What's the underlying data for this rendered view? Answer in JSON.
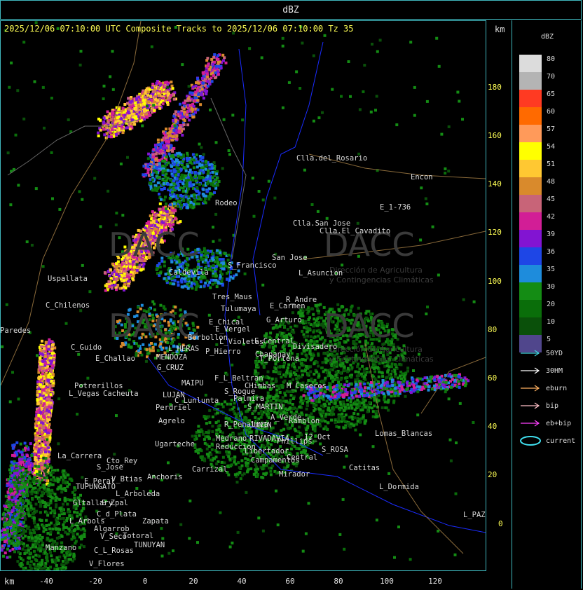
{
  "title": "dBZ",
  "header_text": "2025/12/06 07:10:00 UTC Composite Tracks to 2025/12/06 07:10:00 Tz 35",
  "axis_unit": "km",
  "y_ticks": [
    "180",
    "160",
    "140",
    "120",
    "100",
    "80",
    "60",
    "40",
    "20",
    "0"
  ],
  "x_ticks": [
    "-40",
    "-20",
    "0",
    "20",
    "40",
    "60",
    "80",
    "100",
    "120"
  ],
  "legend_title": "dBZ",
  "legend": [
    {
      "label": "80",
      "color": "#dcdcdc"
    },
    {
      "label": "70",
      "color": "#b4b4b4"
    },
    {
      "label": "65",
      "color": "#ff3a22"
    },
    {
      "label": "60",
      "color": "#ff6a00"
    },
    {
      "label": "57",
      "color": "#ff9a5a"
    },
    {
      "label": "54",
      "color": "#ffff00"
    },
    {
      "label": "51",
      "color": "#ffc832"
    },
    {
      "label": "48",
      "color": "#d98a2c"
    },
    {
      "label": "45",
      "color": "#c86478"
    },
    {
      "label": "42",
      "color": "#d21e96"
    },
    {
      "label": "39",
      "color": "#8214d2"
    },
    {
      "label": "36",
      "color": "#1e46e6"
    },
    {
      "label": "35",
      "color": "#1e8cdc"
    },
    {
      "label": "30",
      "color": "#148c14"
    },
    {
      "label": "20",
      "color": "#0a6e0a"
    },
    {
      "label": "10",
      "color": "#0a500a"
    },
    {
      "label": "5",
      "color": "#50468c"
    }
  ],
  "tracks": [
    {
      "label": "50YD",
      "color": "#40d0d8",
      "icon": "arrow-icon"
    },
    {
      "label": "30HM",
      "color": "#ffffff",
      "icon": "arrow-icon"
    },
    {
      "label": "eburn",
      "color": "#ffb060",
      "icon": "arrow-icon"
    },
    {
      "label": "bip",
      "color": "#ffc0c8",
      "icon": "arrow-icon"
    },
    {
      "label": "eb+bip",
      "color": "#ff40ff",
      "icon": "arrow-icon"
    },
    {
      "label": "current",
      "color": "#40e0f0",
      "icon": "ellipse-icon"
    }
  ],
  "watermark": {
    "text": "DACC",
    "subtitle_1": "Dirección de Agricultura",
    "subtitle_2": "y Contingencias Climáticas"
  },
  "places": [
    {
      "name": "Clla.del_Rosario"
    },
    {
      "name": "Encon"
    },
    {
      "name": "E_1-736"
    },
    {
      "name": "Rodeo"
    },
    {
      "name": "Clla.San Jose"
    },
    {
      "name": "Clla.El_Cavadito"
    },
    {
      "name": "Uspallata"
    },
    {
      "name": "Caldevila"
    },
    {
      "name": "S_Francisco"
    },
    {
      "name": "San Jose"
    },
    {
      "name": "L_Asuncion"
    },
    {
      "name": "C_Chilenos"
    },
    {
      "name": "Tres_Maus"
    },
    {
      "name": "Tulumaya"
    },
    {
      "name": "E_Carmen"
    },
    {
      "name": "R_Andre"
    },
    {
      "name": "G_Arturo"
    },
    {
      "name": "E_Chical"
    },
    {
      "name": "E_Vergel"
    },
    {
      "name": "Borbollon"
    },
    {
      "name": "L_Violetas"
    },
    {
      "name": "E_Central"
    },
    {
      "name": "Divisadero"
    },
    {
      "name": "P_Hierro"
    },
    {
      "name": "C_Guido"
    },
    {
      "name": "E_Challao"
    },
    {
      "name": "L_HERAS"
    },
    {
      "name": "MENDOZA"
    },
    {
      "name": "T_Portena"
    },
    {
      "name": "G_CRUZ"
    },
    {
      "name": "Chapanay"
    },
    {
      "name": "Potrerillos"
    },
    {
      "name": "L_Vegas"
    },
    {
      "name": "Cacheuta"
    },
    {
      "name": "MAIPU"
    },
    {
      "name": "F_L_Beltran"
    },
    {
      "name": "C_Lunlunta"
    },
    {
      "name": "CHimbas"
    },
    {
      "name": "M_Caseros"
    },
    {
      "name": "LUJAN"
    },
    {
      "name": "S_Roque"
    },
    {
      "name": "Perdriel"
    },
    {
      "name": "Palmira"
    },
    {
      "name": "S_MARTIN"
    },
    {
      "name": "A_Verde"
    },
    {
      "name": "Agrelo"
    },
    {
      "name": "R_Penaloza"
    },
    {
      "name": "JUNIN"
    },
    {
      "name": "Ramblon"
    },
    {
      "name": "Lomas_Blancas"
    },
    {
      "name": "Ugarteche"
    },
    {
      "name": "Medrano"
    },
    {
      "name": "RIVADAVIA"
    },
    {
      "name": "Phillips"
    },
    {
      "name": "12_Oct"
    },
    {
      "name": "Reduccion"
    },
    {
      "name": "Libertador"
    },
    {
      "name": "S_ROSA"
    },
    {
      "name": "La_Carrera"
    },
    {
      "name": "Cto_Rey"
    },
    {
      "name": "Carrizal"
    },
    {
      "name": "Campamentos"
    },
    {
      "name": "Central"
    },
    {
      "name": "Catitas"
    },
    {
      "name": "S_Jose"
    },
    {
      "name": "E_Peral"
    },
    {
      "name": "V_Btias"
    },
    {
      "name": "Anchoris"
    },
    {
      "name": "Mirador"
    },
    {
      "name": "TUPUNGATO"
    },
    {
      "name": "L_Arboleda"
    },
    {
      "name": "L_Dormida"
    },
    {
      "name": "Gltallary"
    },
    {
      "name": "E_Zpal"
    },
    {
      "name": "C_d_Plata"
    },
    {
      "name": "L_Arbols"
    },
    {
      "name": "Zapata"
    },
    {
      "name": "L_PAZ"
    },
    {
      "name": "Algarrob"
    },
    {
      "name": "V_Seco"
    },
    {
      "name": "Totoral"
    },
    {
      "name": "TUNUYAN"
    },
    {
      "name": "Manzano"
    },
    {
      "name": "C_L_Rosas"
    },
    {
      "name": "V_Flores"
    },
    {
      "name": "Paredes"
    }
  ]
}
